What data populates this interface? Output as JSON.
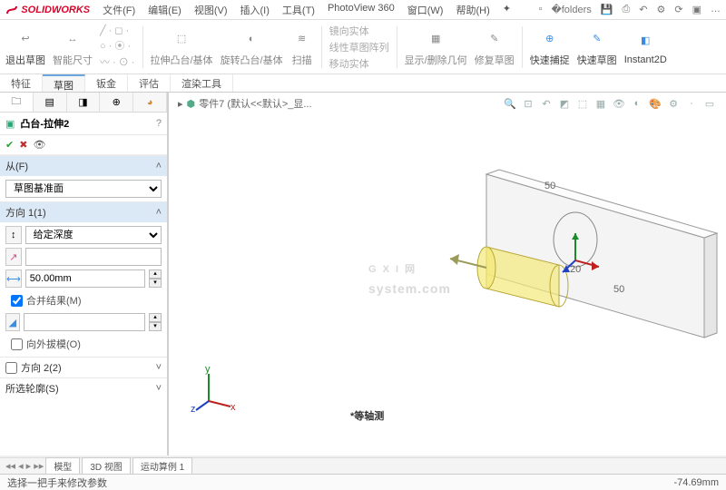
{
  "app": {
    "name": "SOLIDWORKS"
  },
  "menu": {
    "file": "文件(F)",
    "edit": "编辑(E)",
    "view": "视图(V)",
    "insert": "插入(I)",
    "tools": "工具(T)",
    "photoview": "PhotoView 360",
    "window": "窗口(W)",
    "help": "帮助(H)"
  },
  "ribbon": {
    "exit_sketch": "退出草图",
    "smart_dim": "智能尺寸",
    "extrude": "拉伸凸台/基体",
    "revolve": "旋转凸台/基体",
    "sweep": "扫描",
    "mirror": "镜向实体",
    "pattern": "线性草图阵列",
    "move": "移动实体",
    "show": "显示/删除几何",
    "repair": "修复草图",
    "quick_snap": "快速捕捉",
    "quick_sketch": "快速草图",
    "instant": "Instant2D"
  },
  "tabs": {
    "feature": "特征",
    "sketch": "草图",
    "sheet": "钣金",
    "eval": "评估",
    "render": "渲染工具"
  },
  "tree": {
    "title": "凸台-拉伸2"
  },
  "panel": {
    "from_hdr": "从(F)",
    "from_opt": "草图基准面",
    "dir1_hdr": "方向 1(1)",
    "depth_opt": "给定深度",
    "depth_val": "50.00mm",
    "merge": "合并结果(M)",
    "out_draft": "向外拔模(O)",
    "dir2_hdr": "方向 2(2)",
    "sel_contour_hdr": "所选轮廓(S)"
  },
  "breadcrumb": {
    "part": "零件7  (默认<<默认>_显..."
  },
  "view_label": "*等轴测",
  "bottom_tabs": {
    "model": "模型",
    "view3d": "3D 视图",
    "motion": "运动算例 1"
  },
  "status": {
    "msg": "选择一把手来修改参数",
    "coord": "-74.69mm"
  },
  "watermark": {
    "big": "G X I 网",
    "small": "system.com"
  },
  "dims": {
    "d1": "50",
    "d2": "20",
    "d3": "50"
  }
}
